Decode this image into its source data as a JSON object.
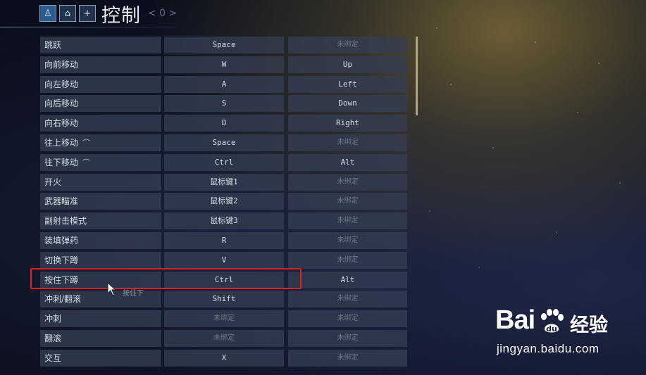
{
  "header": {
    "title": "控制",
    "tail": "< 0 >",
    "icons": [
      "figure-icon",
      "garage-icon",
      "plus-icon"
    ]
  },
  "bindings": [
    {
      "action": "跳跃",
      "key1": "Space",
      "key2": "未绑定",
      "key1_dim": false,
      "key2_dim": true,
      "glyph": ""
    },
    {
      "action": "向前移动",
      "key1": "W",
      "key2": "Up",
      "key1_dim": false,
      "key2_dim": false,
      "glyph": ""
    },
    {
      "action": "向左移动",
      "key1": "A",
      "key2": "Left",
      "key1_dim": false,
      "key2_dim": false,
      "glyph": ""
    },
    {
      "action": "向后移动",
      "key1": "S",
      "key2": "Down",
      "key1_dim": false,
      "key2_dim": false,
      "glyph": ""
    },
    {
      "action": "向右移动",
      "key1": "D",
      "key2": "Right",
      "key1_dim": false,
      "key2_dim": false,
      "glyph": ""
    },
    {
      "action": "往上移动",
      "key1": "Space",
      "key2": "未绑定",
      "key1_dim": false,
      "key2_dim": true,
      "glyph": "⌒"
    },
    {
      "action": "往下移动",
      "key1": "Ctrl",
      "key2": "Alt",
      "key1_dim": false,
      "key2_dim": false,
      "glyph": "⌒"
    },
    {
      "action": "开火",
      "key1": "鼠标键1",
      "key2": "未绑定",
      "key1_dim": false,
      "key2_dim": true,
      "glyph": ""
    },
    {
      "action": "武器瞄准",
      "key1": "鼠标键2",
      "key2": "未绑定",
      "key1_dim": false,
      "key2_dim": true,
      "glyph": ""
    },
    {
      "action": "副射击模式",
      "key1": "鼠标键3",
      "key2": "未绑定",
      "key1_dim": false,
      "key2_dim": true,
      "glyph": ""
    },
    {
      "action": "装填弹药",
      "key1": "R",
      "key2": "未绑定",
      "key1_dim": false,
      "key2_dim": true,
      "glyph": ""
    },
    {
      "action": "切换下蹲",
      "key1": "V",
      "key2": "未绑定",
      "key1_dim": false,
      "key2_dim": true,
      "glyph": ""
    },
    {
      "action": "按住下蹲",
      "key1": "Ctrl",
      "key2": "Alt",
      "key1_dim": false,
      "key2_dim": false,
      "glyph": ""
    },
    {
      "action": "冲刺/翻滚",
      "key1": "Shift",
      "key2": "未绑定",
      "key1_dim": false,
      "key2_dim": true,
      "glyph": ""
    },
    {
      "action": "冲刺",
      "key1": "未绑定",
      "key2": "未绑定",
      "key1_dim": true,
      "key2_dim": true,
      "glyph": ""
    },
    {
      "action": "翻滚",
      "key1": "未绑定",
      "key2": "未绑定",
      "key1_dim": true,
      "key2_dim": true,
      "glyph": ""
    },
    {
      "action": "交互",
      "key1": "X",
      "key2": "未绑定",
      "key1_dim": false,
      "key2_dim": true,
      "glyph": ""
    }
  ],
  "tooltip": "按住下",
  "watermark": {
    "brand": "Bai",
    "brand_cn": "经验",
    "url": "jingyan.baidu.com"
  },
  "colors": {
    "highlight_border": "#e02020",
    "cell_bg": "rgba(52,62,82,0.78)",
    "scrollbar": "#c6b98c"
  }
}
